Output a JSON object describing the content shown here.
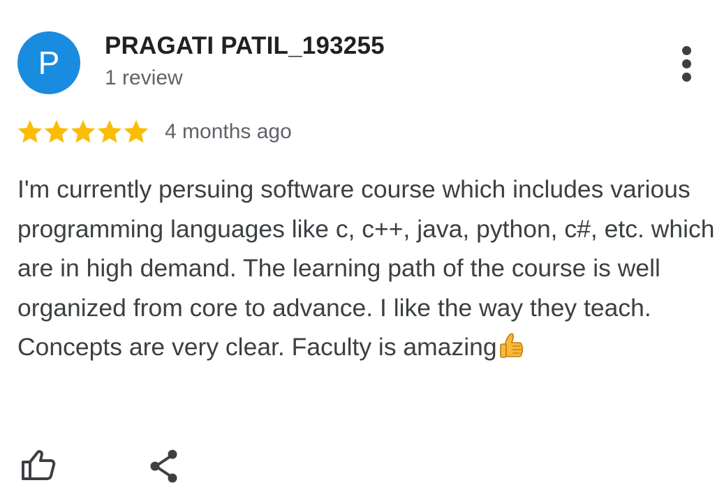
{
  "author": {
    "avatar_letter": "P",
    "avatar_color": "#1a8ce0",
    "name": "PRAGATI PATIL_193255",
    "review_count_text": "1 review"
  },
  "rating": {
    "stars": 5,
    "max_stars": 5,
    "star_color": "#fbbc04",
    "date_text": "4 months ago"
  },
  "review": {
    "text": "I'm currently persuing software course which includes various programming languages like c, c++, java, python, c#, etc. which are in high demand. The learning path of the course is well organized from core to advance. I like the way they teach. Concepts are very clear. Faculty is amazing",
    "trailing_emoji": "thumbs-up-emoji"
  },
  "actions": {
    "more_icon": "more-vertical-icon",
    "like_icon": "thumbs-up-outline-icon",
    "share_icon": "share-icon"
  }
}
